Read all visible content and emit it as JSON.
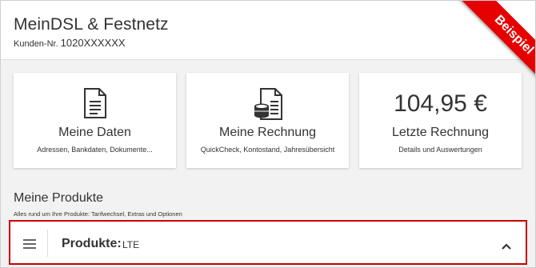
{
  "header": {
    "title": "MeinDSL & Festnetz",
    "customer_label": "Kunden-Nr.",
    "customer_number": "1020XXXXXX"
  },
  "ribbon": {
    "label": "Beispiel",
    "color": "#e60000"
  },
  "cards": [
    {
      "title": "Meine Daten",
      "description": "Adressen, Bankdaten, Dokumente...",
      "icon": "document-icon"
    },
    {
      "title": "Meine Rechnung",
      "description": "QuickCheck, Kontostand, Jahresübersicht",
      "icon": "invoice-coins-icon"
    },
    {
      "amount": "104,95 €",
      "title": "Letzte Rechnung",
      "description": "Details und Auswertungen"
    }
  ],
  "products_section": {
    "title": "Meine Produkte",
    "subtitle": "Alles rund um Ihre Produkte: Tarifwechsel, Extras und Optionen"
  },
  "product_bar": {
    "label": "Produkte:",
    "value": "LTE",
    "border_color": "#c80000",
    "icons": [
      "hamburger-menu-icon",
      "chevron-up-icon"
    ]
  }
}
